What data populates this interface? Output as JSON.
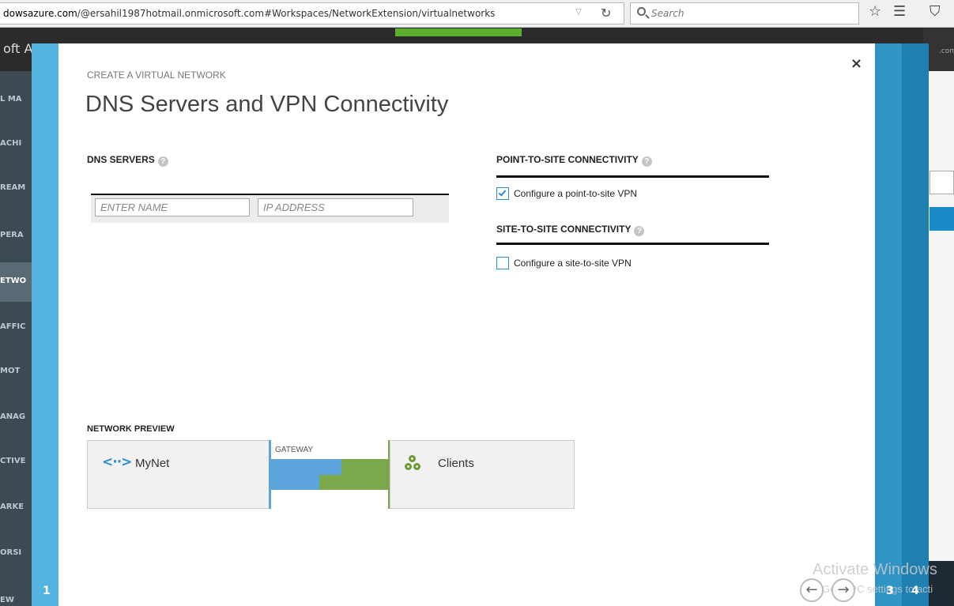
{
  "browser": {
    "url_prefix": "dowsazure.com",
    "url_rest": "/@ersahil1987hotmail.onmicrosoft.com#Workspaces/NetworkExtension/virtualnetworks",
    "search_placeholder": "Search"
  },
  "background": {
    "brand_fragment": "oft A",
    "right_fragment": ".com",
    "sidebar_items": [
      "L MA",
      "ACHI",
      "REAM",
      "PERA",
      "ETWO",
      "AFFIC",
      "MOT",
      "ANAG",
      "CTIVE",
      "ARKE",
      "ORSI",
      "EW"
    ]
  },
  "wizard": {
    "subtitle": "CREATE A VIRTUAL NETWORK",
    "title": "DNS Servers and VPN Connectivity",
    "dns": {
      "heading": "DNS SERVERS",
      "name_placeholder": "ENTER NAME",
      "ip_placeholder": "IP ADDRESS"
    },
    "p2s": {
      "heading": "POINT-TO-SITE CONNECTIVITY",
      "checkbox_label": "Configure a point-to-site VPN",
      "checked": true
    },
    "s2s": {
      "heading": "SITE-TO-SITE CONNECTIVITY",
      "checkbox_label": "Configure a site-to-site VPN",
      "checked": false
    },
    "preview": {
      "heading": "NETWORK PREVIEW",
      "network_name": "MyNet",
      "gateway_label": "GATEWAY",
      "clients_label": "Clients"
    },
    "steps": {
      "left": "1",
      "right_a": "3",
      "right_b": "4"
    },
    "close_glyph": "×",
    "help_glyph": "?",
    "vnet_glyph": "<··>",
    "back_glyph": "←",
    "next_glyph": "→"
  },
  "watermark": {
    "line1": "Activate Windows",
    "line2": "Go to PC settings to acti"
  },
  "colors": {
    "accent": "#2a8dd4",
    "gateway_blue": "#5ba4dc",
    "gateway_green": "#7aa84a",
    "step_left": "#55b3e0",
    "step_right": "#2f95c4"
  }
}
